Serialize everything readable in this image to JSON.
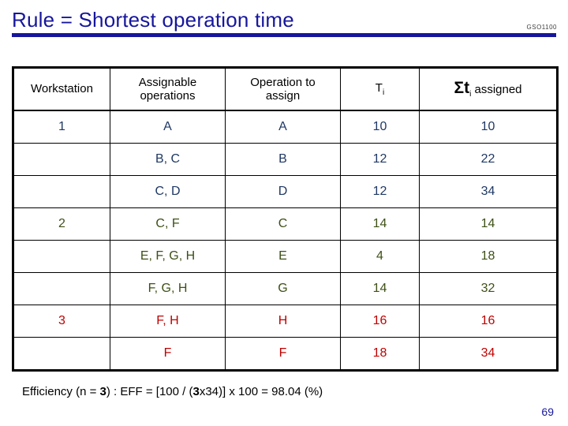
{
  "slide": {
    "title": "Rule = Shortest operation time",
    "course_code": "GSO1100",
    "page_number": "69",
    "title_color": "#16169c"
  },
  "table": {
    "headers": [
      {
        "label": "Workstation",
        "line2": ""
      },
      {
        "label": "Assignable",
        "line2": "operations"
      },
      {
        "label": "Operation to",
        "line2": "assign"
      },
      {
        "label": "T",
        "sub": "i",
        "line2": ""
      },
      {
        "label": "Σt",
        "sub": "i",
        "line2": " assigned"
      }
    ],
    "colors": {
      "group1": "#1F3864",
      "group2": "#3D5016",
      "group3": "#C00000"
    },
    "rows": [
      {
        "workstation": "1",
        "assignable": "A",
        "operation": "A",
        "ti": "10",
        "sum": "10",
        "group": "grp-blue"
      },
      {
        "workstation": "",
        "assignable": "B, C",
        "operation": "B",
        "ti": "12",
        "sum": "22",
        "group": "grp-blue"
      },
      {
        "workstation": "",
        "assignable": "C, D",
        "operation": "D",
        "ti": "12",
        "sum": "34",
        "group": "grp-blue"
      },
      {
        "workstation": "2",
        "assignable": "C, F",
        "operation": "C",
        "ti": "14",
        "sum": "14",
        "group": "grp-green"
      },
      {
        "workstation": "",
        "assignable": "E, F, G, H",
        "operation": "E",
        "ti": "4",
        "sum": "18",
        "group": "grp-green"
      },
      {
        "workstation": "",
        "assignable": "F, G, H",
        "operation": "G",
        "ti": "14",
        "sum": "32",
        "group": "grp-green"
      },
      {
        "workstation": "3",
        "assignable": "F, H",
        "operation": "H",
        "ti": "16",
        "sum": "16",
        "group": "grp-red"
      },
      {
        "workstation": "",
        "assignable": "F",
        "operation": "F",
        "ti": "18",
        "sum": "34",
        "group": "grp-red"
      }
    ]
  },
  "efficiency": {
    "prefix": "Efficiency (n = ",
    "n_value": "3",
    "middle": ") : EFF = [100 / (",
    "n_value2": "3",
    "suffix": "x34)] x 100 = 98.04 (%)",
    "full_text": "Efficiency (n = 3) : EFF = [100 / (3x34)] x 100 = 98.04 (%)"
  }
}
